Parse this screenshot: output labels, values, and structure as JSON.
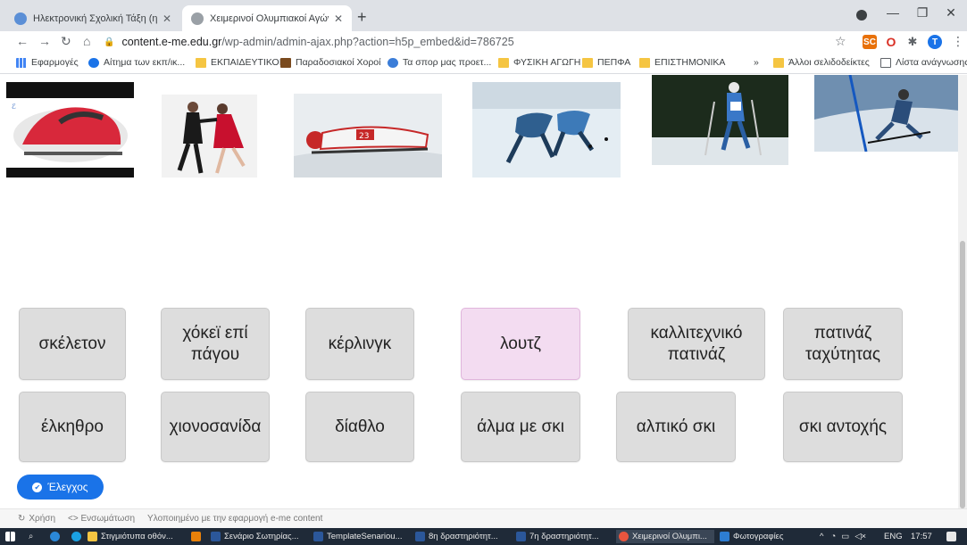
{
  "browser": {
    "tabs": [
      {
        "title": "Ηλεκτρονική Σχολική Τάξη (η-Τά",
        "active": false
      },
      {
        "title": "Χειμερινοί Ολυμπιακοί Αγώνες",
        "active": true
      }
    ],
    "new_tab": "+",
    "url_host": "content.e-me.edu.gr",
    "url_path": "/wp-admin/admin-ajax.php?action=h5p_embed&id=786725",
    "window_controls": {
      "minimize": "—",
      "maximize": "❐",
      "close": "✕"
    }
  },
  "bookmarks": [
    {
      "label": "Εφαρμογές",
      "icon": "apps-icon"
    },
    {
      "label": "Αίτημα των εκπ/ικ...",
      "icon": "globe-icon"
    },
    {
      "label": "ΕΚΠΑΙΔΕΥΤΙΚΟΙ",
      "icon": "folder-icon"
    },
    {
      "label": "Παραδοσιακοί Χοροί",
      "icon": "site-icon"
    },
    {
      "label": "Τα σπορ μας προετ...",
      "icon": "site-icon"
    },
    {
      "label": "ΦΥΣΙΚΗ ΑΓΩΓΗ",
      "icon": "folder-icon"
    },
    {
      "label": "ΠΕΠΦΑ",
      "icon": "folder-icon"
    },
    {
      "label": "ΕΠΙΣΤΗΜΟΝΙΚΑ",
      "icon": "folder-icon"
    },
    {
      "label": "»",
      "icon": ""
    },
    {
      "label": "Άλλοι σελιδοδείκτες",
      "icon": "folder-icon"
    },
    {
      "label": "Λίστα ανάγνωσης",
      "icon": "reading-list-icon"
    }
  ],
  "images": [
    {
      "sport": "skeleton",
      "icon": "skeleton-image"
    },
    {
      "sport": "ice-dance",
      "icon": "ice-dance-image"
    },
    {
      "sport": "luge",
      "icon": "luge-image"
    },
    {
      "sport": "speed-skating",
      "icon": "speed-skating-image"
    },
    {
      "sport": "cross-country",
      "icon": "cross-country-image"
    },
    {
      "sport": "alpine-ski",
      "icon": "alpine-ski-image"
    }
  ],
  "words": [
    {
      "text": "σκέλετον",
      "selected": false
    },
    {
      "text": "χόκεϊ επί πάγου",
      "selected": false
    },
    {
      "text": "κέρλινγκ",
      "selected": false
    },
    {
      "text": "λουτζ",
      "selected": true
    },
    {
      "text": "καλλιτεχνικό πατινάζ",
      "selected": false
    },
    {
      "text": "πατινάζ ταχύτητας",
      "selected": false
    },
    {
      "text": "έλκηθρο",
      "selected": false
    },
    {
      "text": "χιονοσανίδα",
      "selected": false
    },
    {
      "text": "δίαθλο",
      "selected": false
    },
    {
      "text": "άλμα με σκι",
      "selected": false
    },
    {
      "text": "αλπικό σκι",
      "selected": false
    },
    {
      "text": "σκι αντοχής",
      "selected": false
    }
  ],
  "check_button": "Έλεγχος",
  "h5p_footer": {
    "reuse": "Χρήση",
    "embed": "<> Ενσωμάτωση",
    "credit": "Υλοποιημένο με την εφαρμογή e-me content"
  },
  "taskbar": {
    "items": [
      {
        "label": "Στιγμιότυπα οθόν...",
        "active": false
      },
      {
        "label": "Σενάριο Σωτηρίας...",
        "active": false
      },
      {
        "label": "TemplateSenariou...",
        "active": false
      },
      {
        "label": "8η δραστηριότητ...",
        "active": false
      },
      {
        "label": "7η δραστηριότητ...",
        "active": false
      },
      {
        "label": "Χειμερινοί Ολυμπι...",
        "active": true
      },
      {
        "label": "Φωτογραφίες",
        "active": false
      }
    ],
    "lang": "ENG",
    "time": "17:57"
  },
  "colors": {
    "accent": "#1a73e8",
    "selected_word": "#f3dcf1",
    "word_bg": "#dddddd"
  }
}
